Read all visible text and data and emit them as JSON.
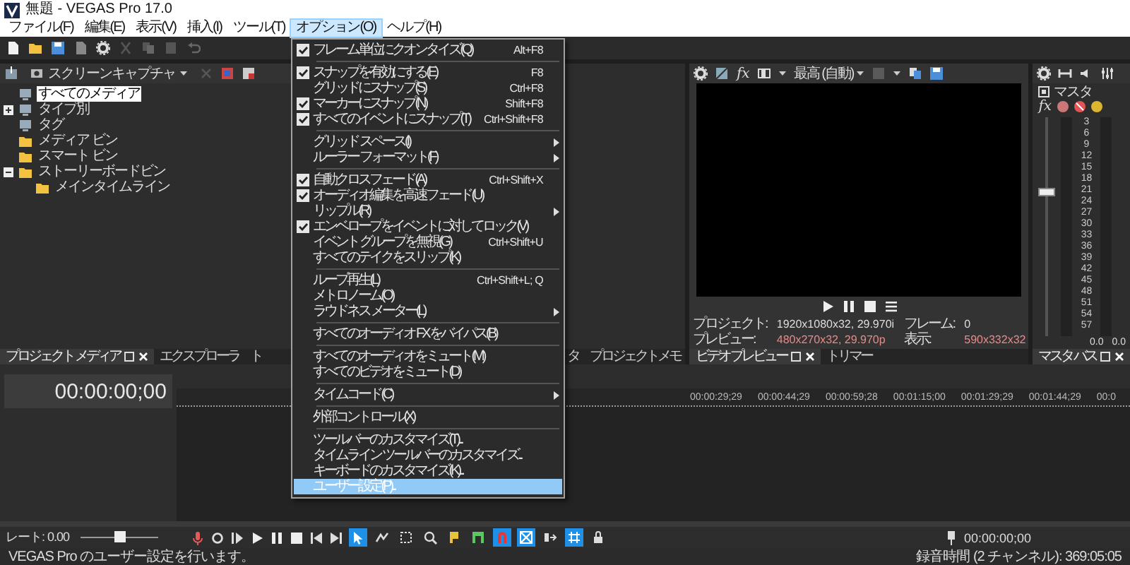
{
  "window": {
    "title": "無題 - VEGAS Pro 17.0"
  },
  "menubar": [
    {
      "label": "ファイル(F)",
      "selected": false
    },
    {
      "label": "編集(E)",
      "selected": false
    },
    {
      "label": "表示(V)",
      "selected": false
    },
    {
      "label": "挿入(I)",
      "selected": false
    },
    {
      "label": "ツール(T)",
      "selected": false
    },
    {
      "label": "オプション(O)",
      "selected": true
    },
    {
      "label": "ヘルプ(H)",
      "selected": false
    }
  ],
  "options_menu": [
    {
      "kind": "item",
      "label": "フレーム単位にクオンタイズ(Q)",
      "checked": true,
      "shortcut": "Alt+F8",
      "submenu": false,
      "selected": false
    },
    {
      "kind": "separator"
    },
    {
      "kind": "item",
      "label": "スナップを有効にする(E)",
      "checked": true,
      "shortcut": "F8",
      "submenu": false,
      "selected": false
    },
    {
      "kind": "item",
      "label": "グリッドにスナップ(S)",
      "checked": false,
      "shortcut": "Ctrl+F8",
      "submenu": false,
      "selected": false
    },
    {
      "kind": "item",
      "label": "マーカーにスナップ(N)",
      "checked": true,
      "shortcut": "Shift+F8",
      "submenu": false,
      "selected": false
    },
    {
      "kind": "item",
      "label": "すべてのイベントにスナップ(T)",
      "checked": true,
      "shortcut": "Ctrl+Shift+F8",
      "submenu": false,
      "selected": false
    },
    {
      "kind": "separator"
    },
    {
      "kind": "item",
      "label": "グリッド スペース(I)",
      "checked": false,
      "submenu": true,
      "selected": false
    },
    {
      "kind": "item",
      "label": "ルーラー フォーマット(F)",
      "checked": false,
      "submenu": true,
      "selected": false
    },
    {
      "kind": "separator"
    },
    {
      "kind": "item",
      "label": "自動クロスフェード(A)",
      "checked": true,
      "shortcut": "Ctrl+Shift+X",
      "submenu": false,
      "selected": false
    },
    {
      "kind": "item",
      "label": "オーディオ編集を高速フェード(U)",
      "checked": true,
      "submenu": false,
      "selected": false
    },
    {
      "kind": "item",
      "label": "リップル(R)",
      "checked": false,
      "submenu": true,
      "selected": false
    },
    {
      "kind": "item",
      "label": "エンベロープをイベントに対してロック(V)",
      "checked": true,
      "submenu": false,
      "selected": false
    },
    {
      "kind": "item",
      "label": "イベント グループを無視(G)",
      "checked": false,
      "shortcut": "Ctrl+Shift+U",
      "submenu": false,
      "selected": false
    },
    {
      "kind": "item",
      "label": "すべてのテイクをスリップ(K)",
      "checked": false,
      "submenu": false,
      "selected": false
    },
    {
      "kind": "separator"
    },
    {
      "kind": "item",
      "label": "ループ再生(L)",
      "checked": false,
      "shortcut": "Ctrl+Shift+L; Q",
      "submenu": false,
      "selected": false
    },
    {
      "kind": "item",
      "label": "メトロノーム(O)",
      "checked": false,
      "submenu": false,
      "selected": false
    },
    {
      "kind": "item",
      "label": "ラウドネス メーター(L)",
      "checked": false,
      "submenu": true,
      "selected": false
    },
    {
      "kind": "separator"
    },
    {
      "kind": "item",
      "label": "すべてのオーディオ FX をバイパス(B)",
      "checked": false,
      "submenu": false,
      "selected": false
    },
    {
      "kind": "separator"
    },
    {
      "kind": "item",
      "label": "すべてのオーディオをミュート(M)",
      "checked": false,
      "submenu": false,
      "selected": false
    },
    {
      "kind": "item",
      "label": "すべてのビデオをミュート(D)",
      "checked": false,
      "submenu": false,
      "selected": false
    },
    {
      "kind": "separator"
    },
    {
      "kind": "item",
      "label": "タイムコード(C)",
      "checked": false,
      "submenu": true,
      "selected": false
    },
    {
      "kind": "separator"
    },
    {
      "kind": "item",
      "label": "外部コントロール(X)",
      "checked": false,
      "submenu": false,
      "selected": false
    },
    {
      "kind": "separator"
    },
    {
      "kind": "item",
      "label": "ツールバーのカスタマイズ(T)...",
      "checked": false,
      "submenu": false,
      "selected": false
    },
    {
      "kind": "item",
      "label": "タイムライン ツールバーのカスタマイズ...",
      "checked": false,
      "submenu": false,
      "selected": false
    },
    {
      "kind": "item",
      "label": "キーボードのカスタマイズ(K)...",
      "checked": false,
      "submenu": false,
      "selected": false
    },
    {
      "kind": "item",
      "label": "ユーザー設定(P)...",
      "checked": false,
      "submenu": false,
      "selected": true
    }
  ],
  "media_panel": {
    "capture_button": "スクリーンキャプチャ",
    "tree": [
      {
        "label": "すべてのメディア",
        "kind": "media",
        "selected": true,
        "expandable": false
      },
      {
        "label": "タイプ別",
        "kind": "media",
        "selected": false,
        "expandable": true,
        "expanded": false
      },
      {
        "label": "タグ",
        "kind": "media",
        "selected": false,
        "expandable": false
      },
      {
        "label": "メディア ビン",
        "kind": "folder",
        "selected": false,
        "expandable": false
      },
      {
        "label": "スマート ビン",
        "kind": "folder",
        "selected": false,
        "expandable": false
      },
      {
        "label": "ストーリーボードビン",
        "kind": "folder",
        "selected": false,
        "expandable": true,
        "expanded": true,
        "children": [
          {
            "label": "メインタイムライン",
            "kind": "folder",
            "selected": false,
            "expandable": false
          }
        ]
      }
    ]
  },
  "bottom_tabs": [
    {
      "label": "プロジェクト メディア",
      "selected": true
    },
    {
      "label": "エクスプローラ",
      "selected": false
    },
    {
      "label": "ト",
      "selected": false
    },
    {
      "label": "タ",
      "selected": false
    },
    {
      "label": "プロジェクトメモ",
      "selected": false
    }
  ],
  "video_preview": {
    "fx_button": "fx",
    "quality": "最高 (自動)",
    "info": [
      {
        "label": "プロジェクト:",
        "value": "1920x1080x32, 29.970i",
        "highlight": false
      },
      {
        "label": "フレーム:",
        "value": "0",
        "highlight": false
      },
      {
        "label": "プレビュー:",
        "value": "480x270x32, 29.970p",
        "highlight": true
      },
      {
        "label": "表示:",
        "value": "590x332x32",
        "highlight": true
      }
    ],
    "tabs": [
      {
        "label": "ビデオ プレビュー",
        "selected": true
      },
      {
        "label": "トリマー",
        "selected": false
      }
    ]
  },
  "master": {
    "title": "マスタ",
    "fx_button": "fx",
    "fader": {
      "level": 0.66
    },
    "scale": [
      "3",
      "6",
      "9",
      "12",
      "15",
      "18",
      "21",
      "24",
      "27",
      "30",
      "33",
      "36",
      "39",
      "42",
      "45",
      "48",
      "51",
      "54",
      "57"
    ],
    "readings": [
      "0.0",
      "0.0"
    ],
    "tabs": [
      {
        "label": "マスタ バス",
        "selected": true
      }
    ]
  },
  "timeline": {
    "timecode": "00:00:00;00",
    "ruler": [
      "00:00:29;29",
      "00:00:44;29",
      "00:00:59;28",
      "00:01:15;00",
      "00:01:29;29",
      "00:01:44;29",
      "00:0"
    ]
  },
  "controls": {
    "rate": "レート: 0.00",
    "rate_slider": {
      "level": 0.5
    },
    "cursor_time": "00:00:00;00",
    "tools": [
      {
        "kind": "normal",
        "active": true
      },
      {
        "kind": "envelope",
        "active": false
      },
      {
        "kind": "selection",
        "active": false
      },
      {
        "kind": "zoom",
        "active": false
      },
      {
        "kind": "marker",
        "active": false
      },
      {
        "kind": "region",
        "active": false
      },
      {
        "kind": "snap",
        "active": true
      },
      {
        "kind": "autocross",
        "active": true
      },
      {
        "kind": "ripple",
        "active": false
      },
      {
        "kind": "grid",
        "active": true
      },
      {
        "kind": "lock",
        "active": false
      }
    ]
  },
  "status_bar": {
    "message": "VEGAS Pro のユーザー設定を行います。",
    "record_time": "録音時間 (2 チャンネル): 369:05:05"
  }
}
